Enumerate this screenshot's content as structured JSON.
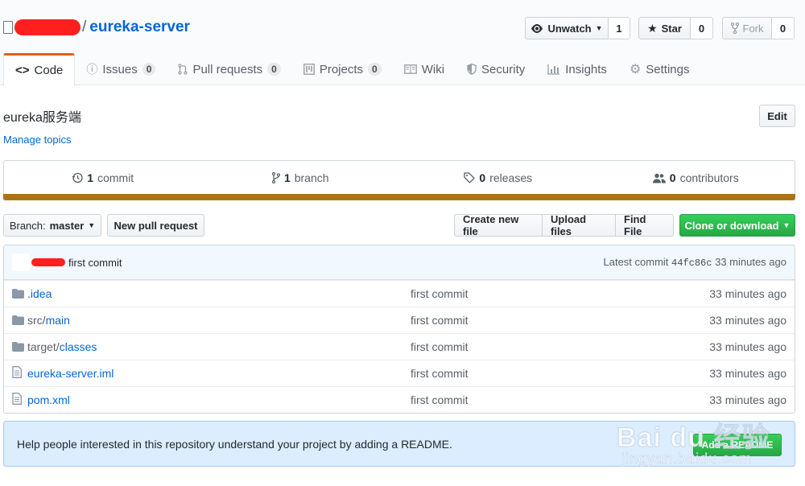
{
  "repo": {
    "owner_label": "",
    "name": "eureka-server",
    "description": "eureka服务端",
    "manage_topics": "Manage topics"
  },
  "actions": {
    "unwatch_label": "Unwatch",
    "watch_count": "1",
    "star_label": "Star",
    "star_count": "0",
    "fork_label": "Fork",
    "fork_count": "0",
    "edit_label": "Edit"
  },
  "tabs": [
    {
      "label": "Code",
      "icon": "code-icon"
    },
    {
      "label": "Issues",
      "count": "0",
      "icon": "issue-icon"
    },
    {
      "label": "Pull requests",
      "count": "0",
      "icon": "pull-request-icon"
    },
    {
      "label": "Projects",
      "count": "0",
      "icon": "project-icon"
    },
    {
      "label": "Wiki",
      "icon": "book-icon"
    },
    {
      "label": "Security",
      "icon": "shield-icon"
    },
    {
      "label": "Insights",
      "icon": "graph-icon"
    },
    {
      "label": "Settings",
      "icon": "gear-icon"
    }
  ],
  "summary": {
    "commits_num": "1",
    "commits_label": "commit",
    "branches_num": "1",
    "branches_label": "branch",
    "releases_num": "0",
    "releases_label": "releases",
    "contributors_num": "0",
    "contributors_label": "contributors",
    "language_color": "#b07219"
  },
  "toolbar": {
    "branch_prefix": "Branch:",
    "branch_name": "master",
    "new_pr": "New pull request",
    "create_file": "Create new file",
    "upload_files": "Upload files",
    "find_file": "Find File",
    "clone": "Clone or download"
  },
  "latest_commit": {
    "message": "first commit",
    "prefix": "Latest commit",
    "sha": "44fc86c",
    "age": "33 minutes ago"
  },
  "files": [
    {
      "dir": "",
      "name": ".idea",
      "type": "folder",
      "message": "first commit",
      "age": "33 minutes ago"
    },
    {
      "dir": "src/",
      "name": "main",
      "type": "folder",
      "message": "first commit",
      "age": "33 minutes ago"
    },
    {
      "dir": "target/",
      "name": "classes",
      "type": "folder",
      "message": "first commit",
      "age": "33 minutes ago"
    },
    {
      "dir": "",
      "name": "eureka-server.iml",
      "type": "file",
      "message": "first commit",
      "age": "33 minutes ago"
    },
    {
      "dir": "",
      "name": "pom.xml",
      "type": "file",
      "message": "first commit",
      "age": "33 minutes ago"
    }
  ],
  "readme": {
    "prompt": "Help people interested in this repository understand your project by adding a README.",
    "button": "Add a README"
  },
  "watermark": {
    "brand": "Bai du 经验",
    "url": "jingyan.baidu.com"
  },
  "colors": {
    "link": "#0366d6",
    "green": "#28a745",
    "tab_accent": "#e36209",
    "redaction": "#ff1f1f"
  }
}
